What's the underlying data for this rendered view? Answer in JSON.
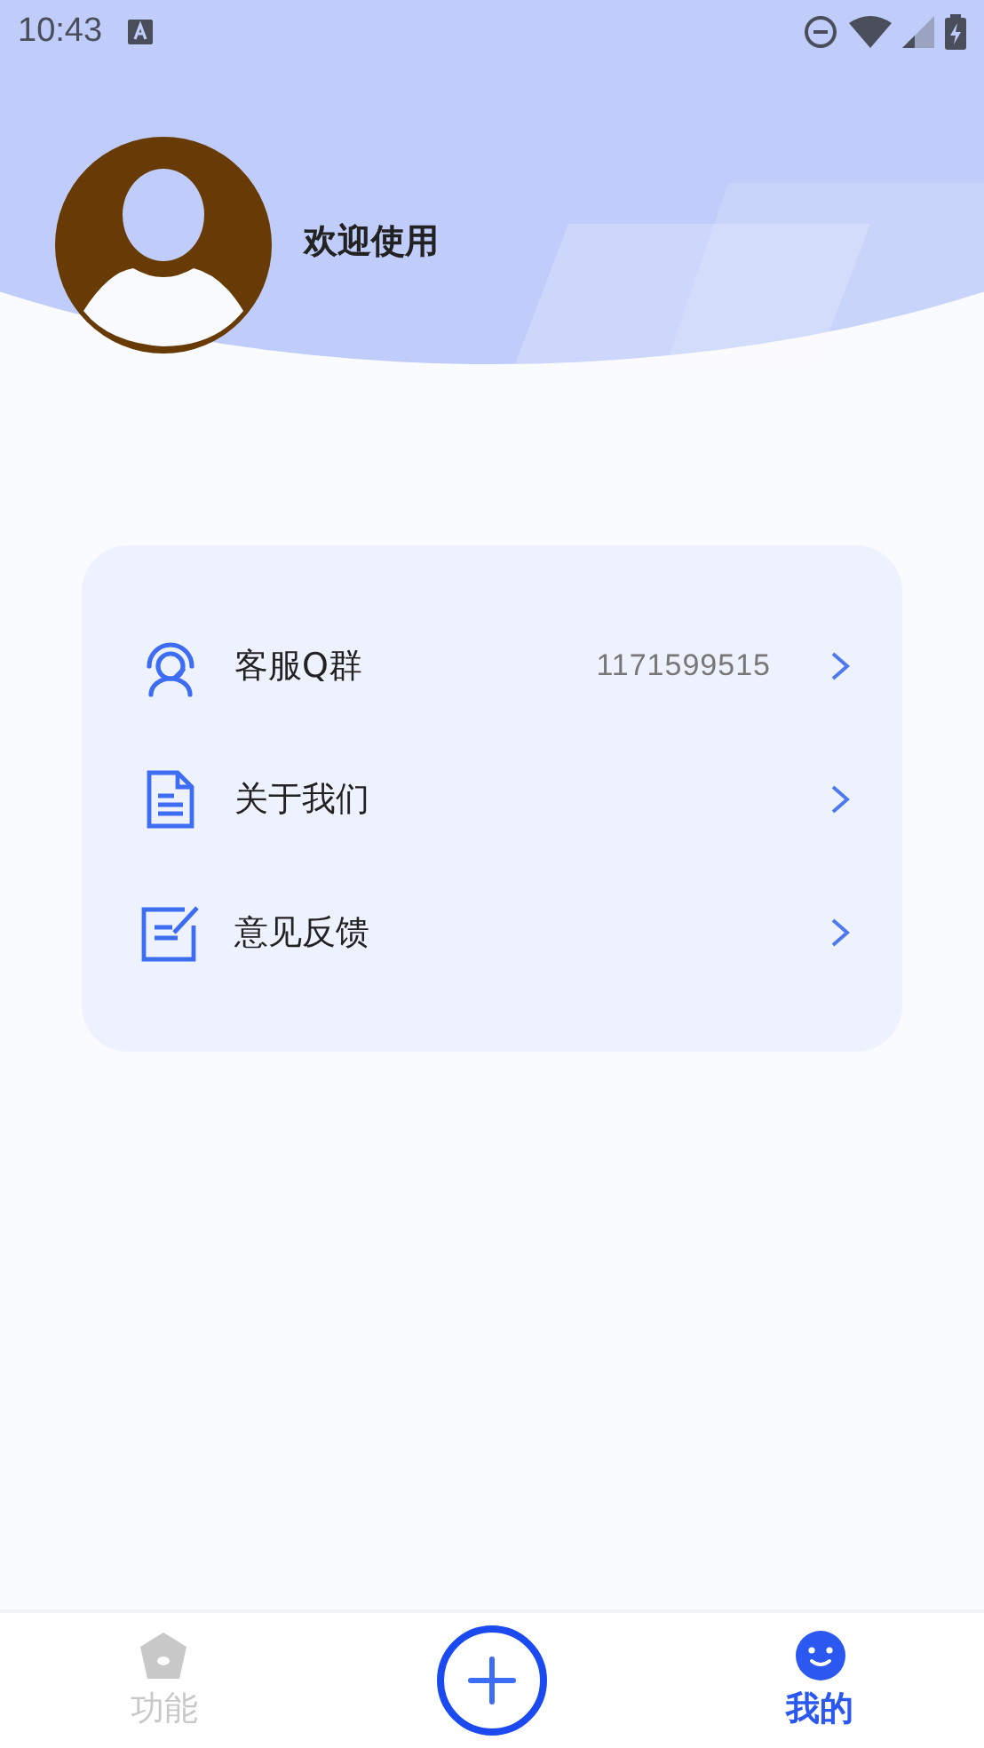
{
  "status_bar": {
    "time": "10:43"
  },
  "profile": {
    "greeting": "欢迎使用"
  },
  "menu": [
    {
      "kind": "headset",
      "label": "客服Q群",
      "value": "1171599515"
    },
    {
      "kind": "document",
      "label": "关于我们"
    },
    {
      "kind": "edit",
      "label": "意见反馈"
    }
  ],
  "bottom_nav": [
    {
      "kind": "functions",
      "label": "功能",
      "selected": false
    },
    {
      "kind": "add"
    },
    {
      "kind": "mine",
      "label": "我的",
      "selected": true
    }
  ]
}
